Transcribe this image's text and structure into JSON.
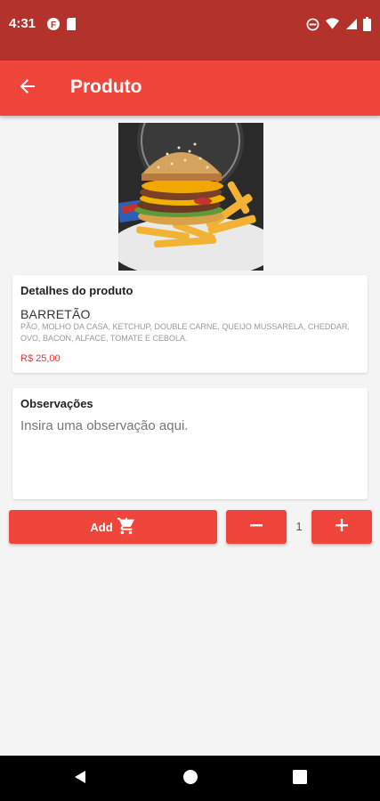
{
  "status_bar": {
    "time": "4:31"
  },
  "app_bar": {
    "title": "Produto"
  },
  "product": {
    "details_heading": "Detalhes do produto",
    "name": "BARRETÃO",
    "description": "PÃO, MOLHO DA CASA, KETCHUP, DOUBLE CARNE, QUEIJO MUSSARELA, CHEDDAR, OVO, BACON, ALFACE, TOMATE E CEBOLA.",
    "price": "R$ 25,00"
  },
  "observations": {
    "heading": "Observações",
    "placeholder": "Insira uma observação aqui.",
    "value": ""
  },
  "actions": {
    "add_label": "Add",
    "quantity": "1"
  },
  "colors": {
    "accent": "#f0453a",
    "status_bar": "#b3322b",
    "price": "#e0392e"
  }
}
